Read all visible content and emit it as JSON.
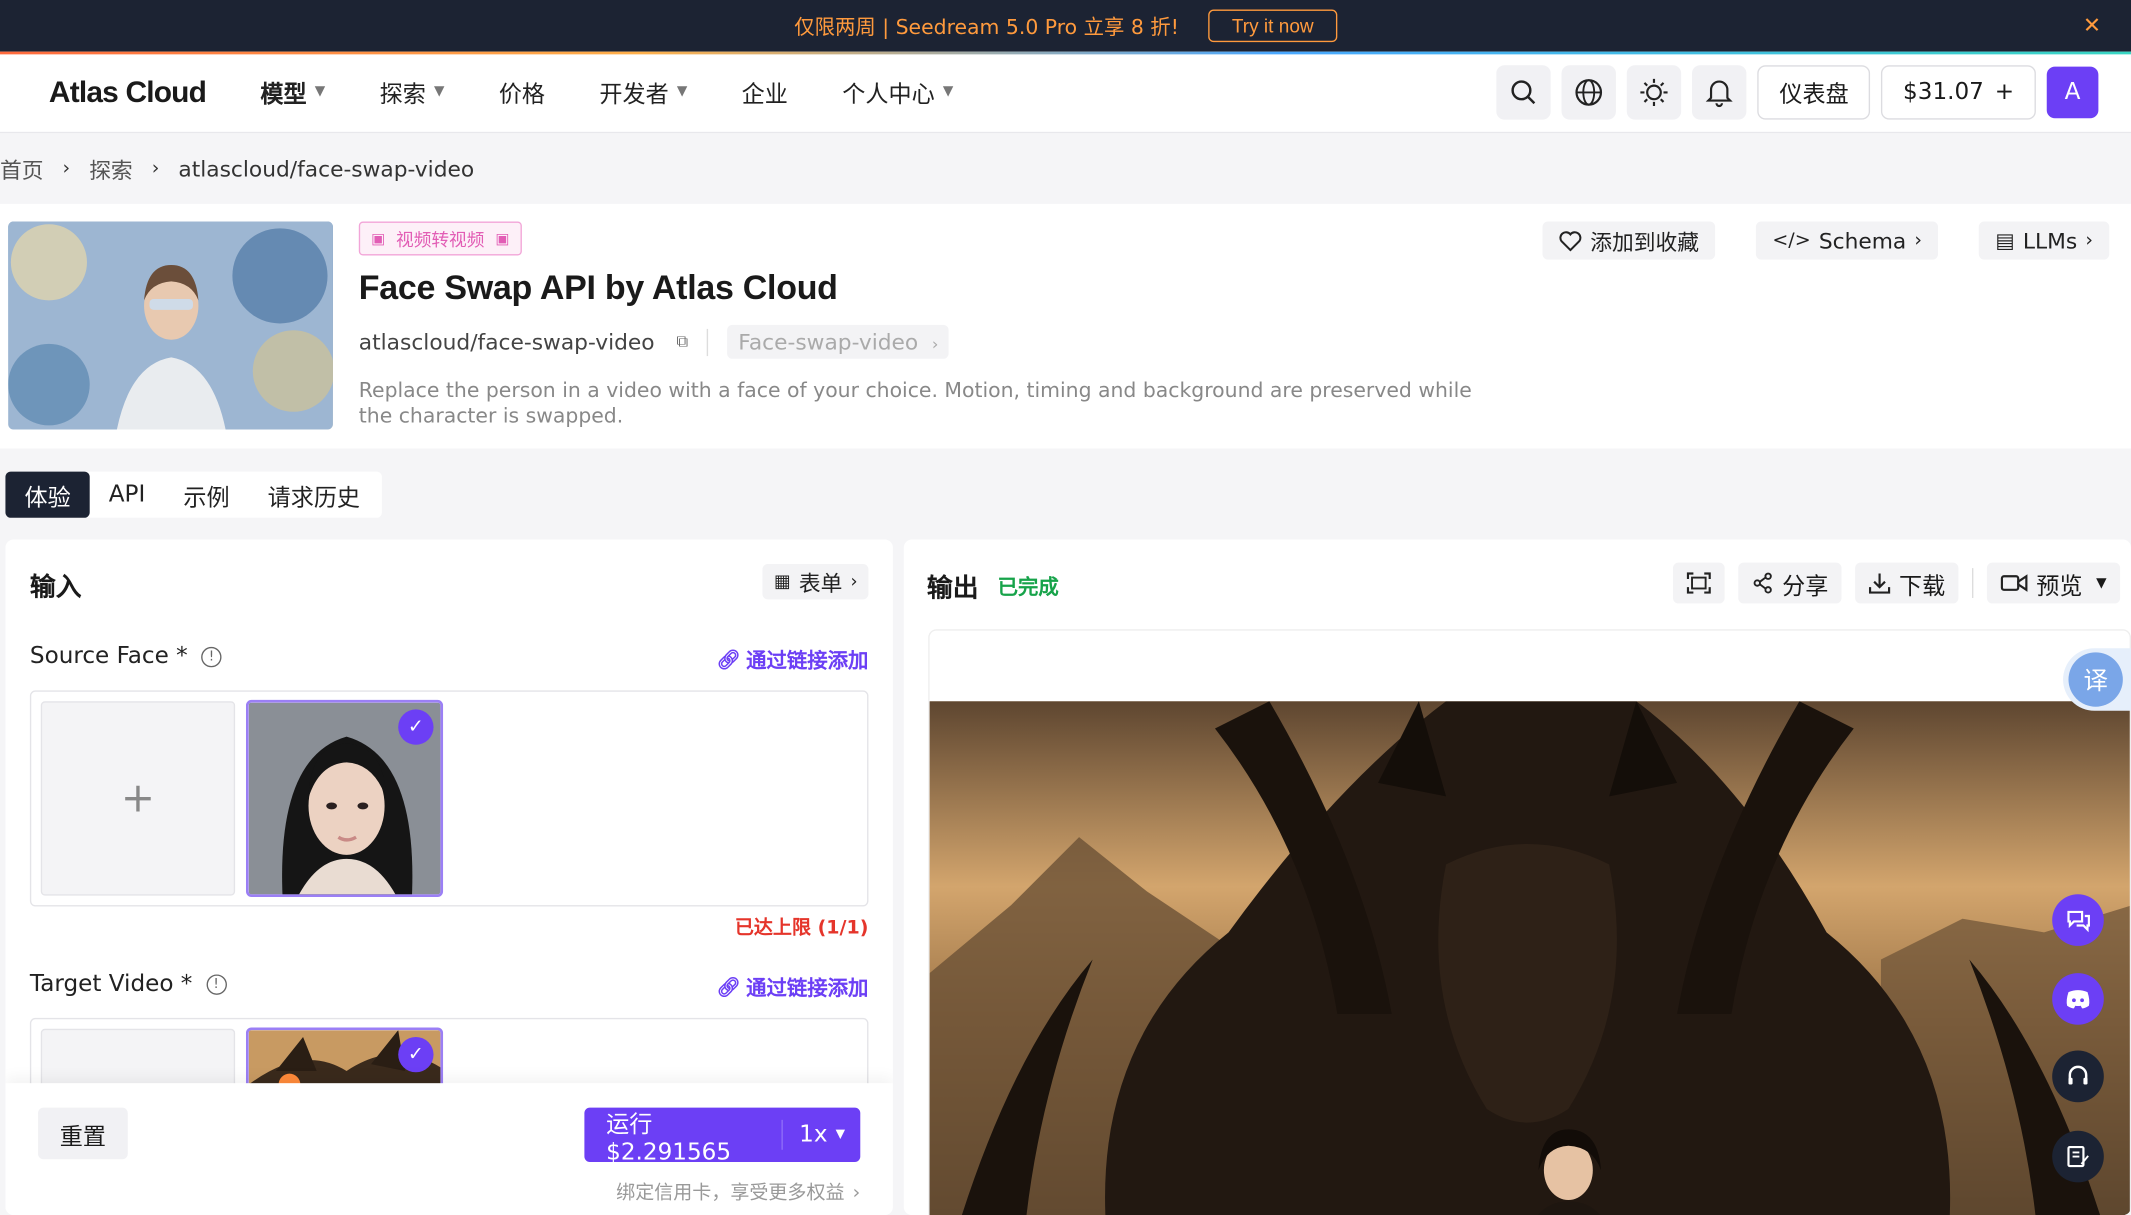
{
  "banner": {
    "text": "仅限两周 | Seedream 5.0 Pro 立享 8 折!",
    "cta": "Try it now",
    "close": "✕"
  },
  "nav": {
    "logo": "Atlas Cloud",
    "items": [
      {
        "label": "模型",
        "dropdown": true
      },
      {
        "label": "探索",
        "dropdown": true
      },
      {
        "label": "价格",
        "dropdown": false
      },
      {
        "label": "开发者",
        "dropdown": true
      },
      {
        "label": "企业",
        "dropdown": false
      },
      {
        "label": "个人中心",
        "dropdown": true
      }
    ],
    "dashboard": "仪表盘",
    "balance": "$31.07",
    "balance_plus": "+",
    "avatar": "A"
  },
  "breadcrumb": {
    "home": "首页",
    "explore": "探索",
    "current": "atlascloud/face-swap-video"
  },
  "model": {
    "tag": "视频转视频",
    "title": "Face Swap API by Atlas Cloud",
    "slug": "atlascloud/face-swap-video",
    "slug_tag": "Face-swap-video",
    "description": "Replace the person in a video with a face of your choice. Motion, timing and background are preserved while the character is swapped.",
    "actions": {
      "favorite": "添加到收藏",
      "schema": "Schema",
      "llms": "LLMs"
    }
  },
  "tabs": [
    "体验",
    "API",
    "示例",
    "请求历史"
  ],
  "input": {
    "title": "输入",
    "form_btn": "表单",
    "source_face": {
      "label": "Source Face *",
      "link": "通过链接添加",
      "limit": "已达上限 (1/1)"
    },
    "target_video": {
      "label": "Target Video *",
      "link": "通过链接添加"
    },
    "reset": "重置",
    "run": "运行 $2.291565",
    "multiplier": "1x",
    "bind_card": "绑定信用卡，享受更多权益"
  },
  "output": {
    "title": "输出",
    "status": "已完成",
    "share": "分享",
    "download": "下载",
    "preview": "预览"
  },
  "translate": "译",
  "colors": {
    "accent": "#6c3ff5",
    "dark": "#1c2333",
    "banner_text": "#ff9a3d",
    "success": "#17a34a",
    "error": "#e5352b"
  }
}
